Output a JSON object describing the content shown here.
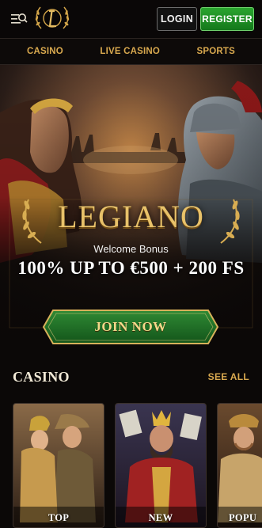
{
  "header": {
    "login_label": "LOGIN",
    "register_label": "REGISTER",
    "logo_icon": "legiano-crest-icon",
    "menu_icon": "menu-search-icon"
  },
  "nav": {
    "items": [
      {
        "label": "CASINO"
      },
      {
        "label": "LIVE CASINO"
      },
      {
        "label": "SPORTS"
      }
    ]
  },
  "hero": {
    "brand": "LEGIANO",
    "subtitle": "Welcome Bonus",
    "offer": "100% UP TO €500 + 200 FS",
    "cta_label": "JOIN NOW"
  },
  "casino": {
    "title": "CASINO",
    "see_all_label": "SEE ALL",
    "cards": [
      {
        "label": "TOP"
      },
      {
        "label": "NEW"
      },
      {
        "label": "POPU"
      }
    ]
  },
  "colors": {
    "accent_gold": "#d9a94f",
    "register_green": "#1f8f25",
    "cta_green": "#1f6b22",
    "background": "#0b0807"
  }
}
